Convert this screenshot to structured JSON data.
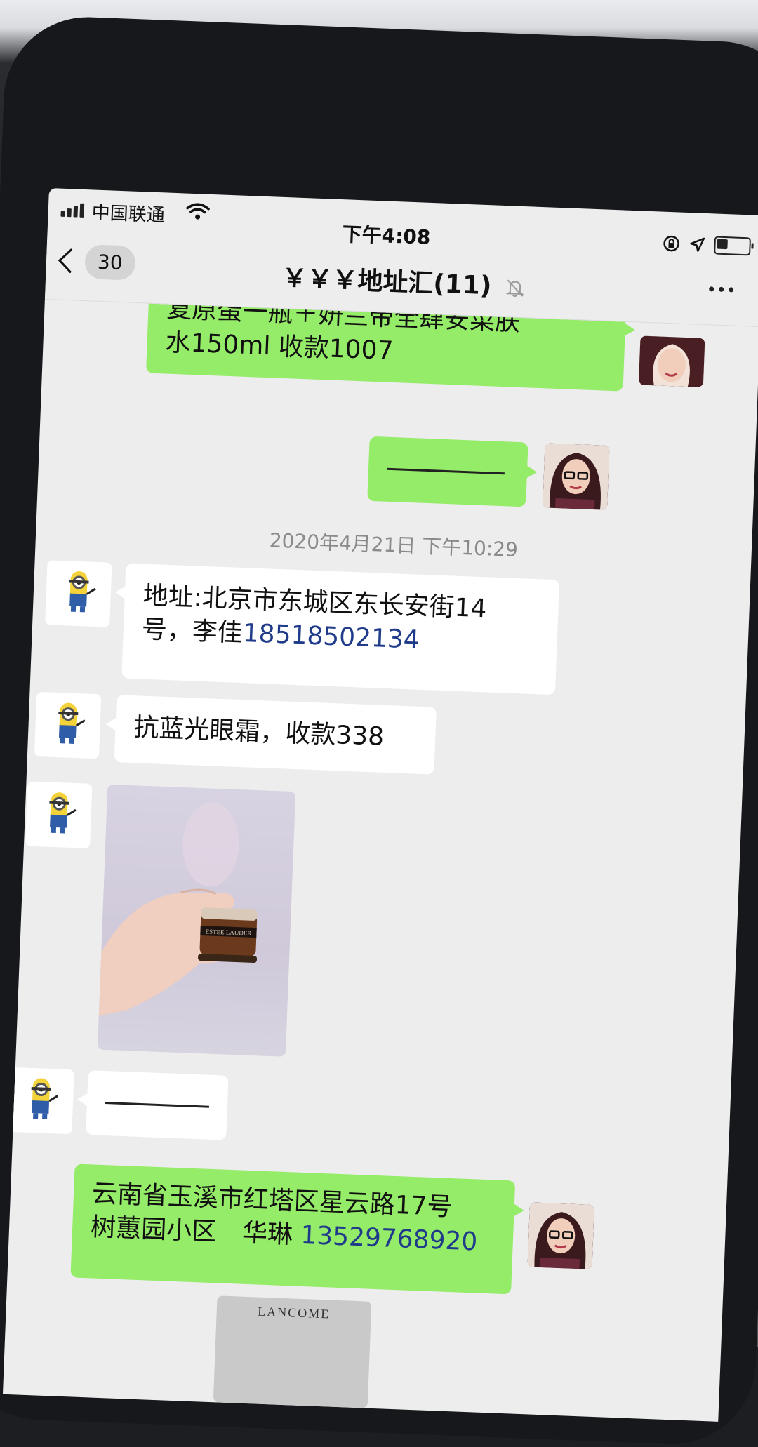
{
  "status_bar": {
    "carrier": "中国联通",
    "time": "下午4:08",
    "battery_level": 0.35
  },
  "nav": {
    "unread_count": "30",
    "title": "￥￥￥地址汇(11)"
  },
  "messages": {
    "m1_line1": "复原蛋一瓶＋妍兰帝全肆安菜肤",
    "m1_line2": "水150ml 收款1007",
    "timestamp": "2020年4月21日 下午10:29",
    "m3_line1": "地址:北京市东城区东长安街14",
    "m3_line2_prefix": "号，李佳",
    "m3_phone": "18518502134",
    "m4": "抗蓝光眼霜，收款338",
    "m7_line1": "云南省玉溪市红塔区星云路17号",
    "m7_line2_prefix": "树蕙园小区　华琳 ",
    "m7_phone": "13529768920",
    "product_brand": "ESTEE LAUDER",
    "bottom_preview_brand": "LANCOME"
  },
  "colors": {
    "outgoing_bubble": "#95ec69",
    "incoming_bubble": "#ffffff",
    "chat_background": "#ededed",
    "link": "#1f3b8a"
  },
  "icons": [
    "signal-icon",
    "wifi-icon",
    "lock-rotation-icon",
    "location-arrow-icon",
    "battery-icon",
    "back-chevron-icon",
    "mute-bell-icon",
    "more-dots-icon"
  ]
}
